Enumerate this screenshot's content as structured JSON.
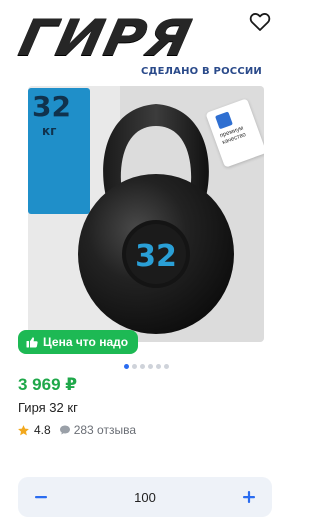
{
  "banner": {
    "brand_word": "ГИРЯ",
    "tagline": "СДЕЛАНО В РОССИИ"
  },
  "photo": {
    "weight_number": "32",
    "weight_unit": "кг",
    "bell_number": "32",
    "badge_text": "премиум качество"
  },
  "promo": {
    "label": "Цена что надо"
  },
  "pager": {
    "count": 6,
    "active_index": 0
  },
  "product": {
    "price": "3 969 ₽",
    "title": "Гиря 32 кг",
    "rating": "4.8",
    "reviews": "283 отзыва"
  },
  "stepper": {
    "value": "100"
  },
  "colors": {
    "accent_blue": "#2a6cf0",
    "price_green": "#1fa84a",
    "promo_green": "#1db954",
    "star": "#f2a81d",
    "tag_blue": "#1f8fc9"
  },
  "icons": {
    "favorite": "heart-outline-icon",
    "promo": "thumbs-up-icon",
    "star": "star-icon",
    "reviews": "comment-icon",
    "minus": "minus-icon",
    "plus": "plus-icon"
  }
}
